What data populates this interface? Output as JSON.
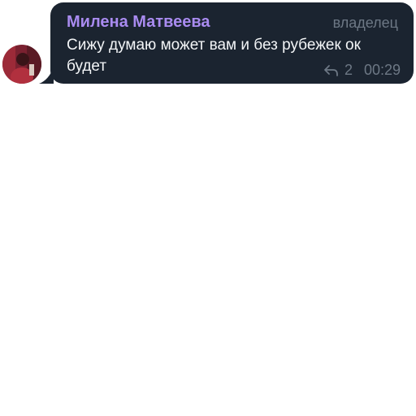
{
  "message": {
    "sender_name": "Милена Матвеева",
    "role": "владелец",
    "text": "Сижу думаю может вам и без рубежек ок будет",
    "reply_count": "2",
    "time": "00:29",
    "reply_icon": "reply-arrow-icon"
  },
  "colors": {
    "bubble_bg": "#1b2430",
    "sender_name": "#a98bf0",
    "text": "#f3f5f7",
    "meta": "#6d7885"
  }
}
